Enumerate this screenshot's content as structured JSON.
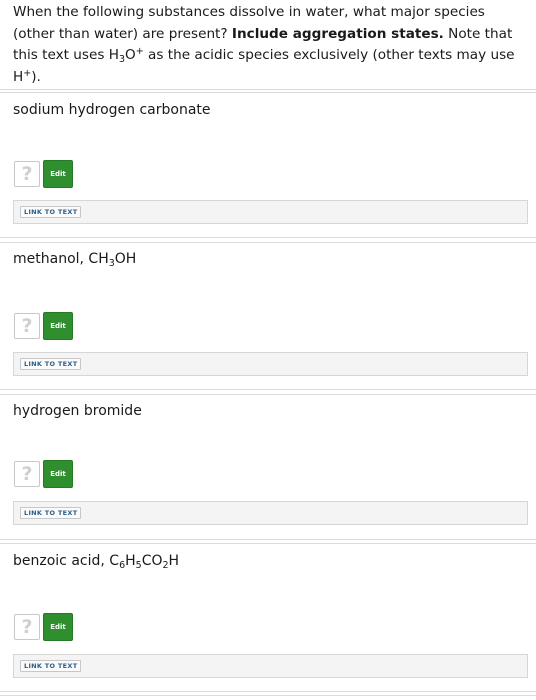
{
  "question": {
    "intro_a": "When the following substances dissolve in water, what major species (other than water) are present? ",
    "intro_bold": "Include aggregation states.",
    "intro_b": " Note that this text uses H",
    "intro_sub": "3",
    "intro_c": "O",
    "intro_sup": "+",
    "intro_d": " as the acidic species exclusively (other texts may use H",
    "intro_sup2": "+",
    "intro_e": ")."
  },
  "parts": [
    {
      "title": "sodium hydrogen carbonate"
    },
    {
      "title_prefix": "methanol, CH",
      "sub1": "3",
      "title_suffix": "OH"
    },
    {
      "title": "hydrogen bromide"
    },
    {
      "title_prefix": "benzoic acid, C",
      "sub1": "6",
      "mid1": "H",
      "sub2": "5",
      "mid2": "CO",
      "sub3": "2",
      "title_suffix": "H"
    }
  ],
  "controls": {
    "help_glyph": "?",
    "edit_label": "Edit",
    "link_label": "LINK TO TEXT"
  }
}
